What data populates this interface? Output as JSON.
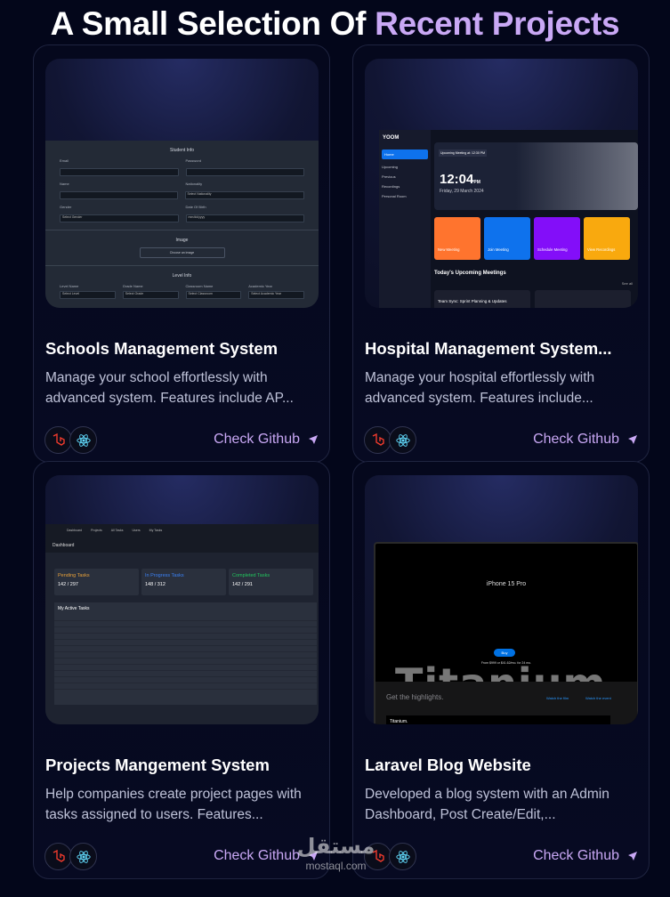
{
  "heading": {
    "part1": "A Small Selection Of ",
    "part2": "Recent Projects"
  },
  "colors": {
    "accent": "#c9a8f5",
    "background": "#03061a"
  },
  "projects": [
    {
      "title": "Schools Management System",
      "description": "Manage your school effortlessly with advanced system. Features include AP...",
      "link_label": "Check Github",
      "tech_icons": [
        "laravel-icon",
        "react-icon"
      ],
      "preview": {
        "section1": "Student Info",
        "labels1": [
          "Email",
          "Password"
        ],
        "labels2": [
          "Name",
          "Nationality"
        ],
        "nationality_placeholder": "Select Nationality",
        "labels3": [
          "Gender",
          "Date Of Birth"
        ],
        "gender_placeholder": "Select Gender",
        "dob_placeholder": "mm/dd/yyyy",
        "section2": "Image",
        "image_button": "Choose an image",
        "section3": "Level Info",
        "labels4": [
          "Level Name",
          "Grade Name",
          "Classroom Name",
          "Academic Year"
        ],
        "selects4": [
          "Select Level",
          "Select Grade",
          "Select Classroom",
          "Select Academic Year"
        ]
      }
    },
    {
      "title": "Hospital Management System...",
      "description": "Manage your hospital effortlessly with advanced system. Features include...",
      "link_label": "Check Github",
      "tech_icons": [
        "laravel-icon",
        "react-icon"
      ],
      "preview": {
        "brand": "YOOM",
        "nav": [
          "Home",
          "Upcoming",
          "Previous",
          "Recordings",
          "Personal Room"
        ],
        "badge": "Upcoming Meeting at: 12:30 PM",
        "time": "12:04",
        "time_suffix": "PM",
        "date": "Friday, 29 March 2024",
        "tiles": [
          "New Meeting",
          "Join Meeting",
          "Schedule Meeting",
          "View Recordings"
        ],
        "subtitle": "Today's Upcoming Meetings",
        "see_all": "See all",
        "meeting": "Team Sync: Sprint Planning & Updates"
      }
    },
    {
      "title": "Projects Mangement System",
      "description": "Help companies create project pages with tasks assigned to users. Features...",
      "link_label": "Check Github",
      "tech_icons": [
        "laravel-icon",
        "react-icon"
      ],
      "preview": {
        "nav": [
          "Dashboard",
          "Projects",
          "All Tasks",
          "Users",
          "My Tasks"
        ],
        "page": "Dashboard",
        "stats": [
          {
            "label": "Pending Tasks",
            "value": "142 / 297",
            "color": "#e8a13a"
          },
          {
            "label": "In Progress Tasks",
            "value": "148 / 312",
            "color": "#3b82f6"
          },
          {
            "label": "Completed Tasks",
            "value": "142 / 291",
            "color": "#22c55e"
          }
        ],
        "table_title": "My Active Tasks"
      }
    },
    {
      "title": "Laravel Blog Website",
      "description": "Developed a blog system with an Admin Dashboard, Post Create/Edit,...",
      "link_label": "Check Github",
      "tech_icons": [
        "laravel-icon",
        "react-icon"
      ],
      "preview": {
        "model": "iPhone 15 Pro",
        "hero": "Titanium",
        "buy": "Buy",
        "price": "From $999 or $41.62/mo. for 24 mo.",
        "highlights": "Get the highlights.",
        "watch": "Watch the film",
        "event": "Watch the event",
        "caption": "Titanium."
      }
    }
  ],
  "watermark": {
    "arabic": "مستقل",
    "latin": "mostaql.com"
  }
}
